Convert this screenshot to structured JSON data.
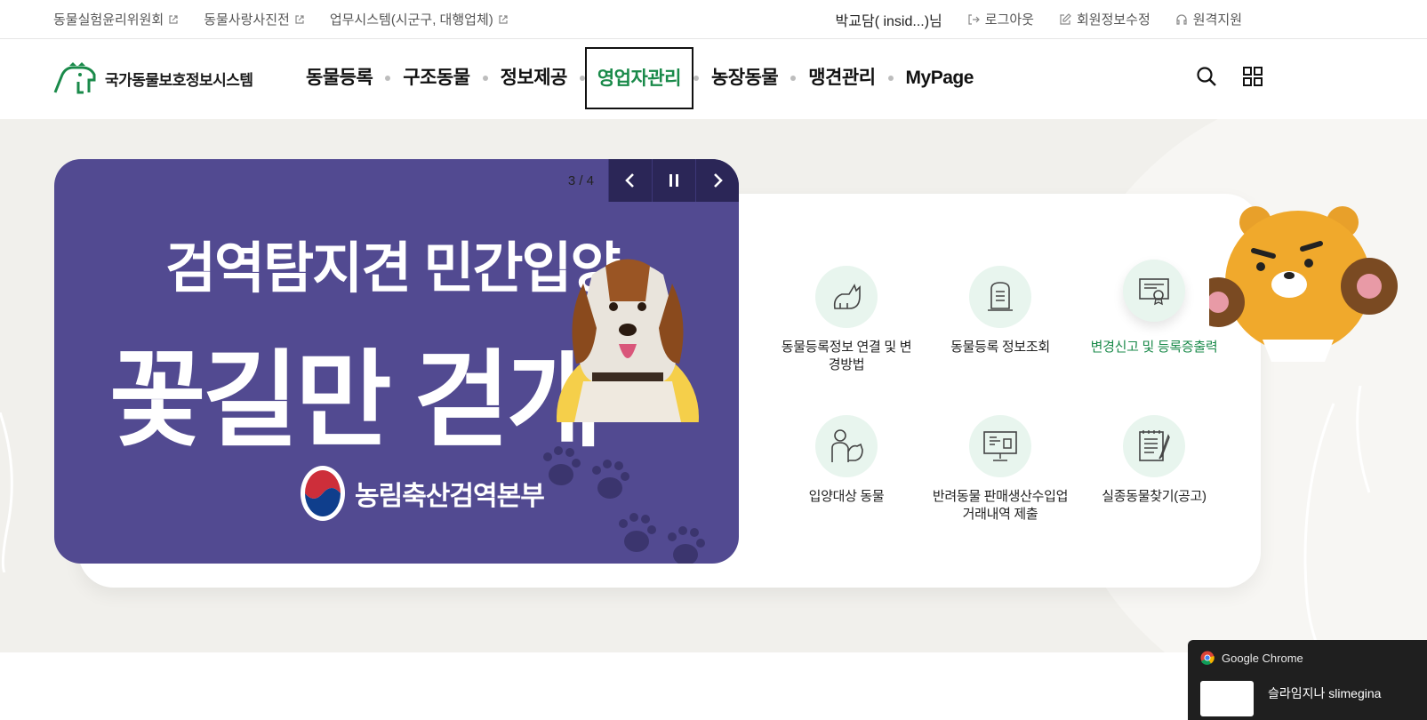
{
  "utility": {
    "links": [
      {
        "label": "동물실험윤리위원회"
      },
      {
        "label": "동물사랑사진전"
      },
      {
        "label": "업무시스템(시군구, 대행업체)"
      }
    ],
    "user_name": "박교담( insid...)님",
    "logout": "로그아웃",
    "edit_profile": "회원정보수정",
    "remote_support": "원격지원"
  },
  "header": {
    "logo_text": "국가동물보호정보시스템",
    "nav": [
      {
        "label": "동물등록"
      },
      {
        "label": "구조동물"
      },
      {
        "label": "정보제공"
      },
      {
        "label": "영업자관리"
      },
      {
        "label": "농장동물"
      },
      {
        "label": "맹견관리"
      },
      {
        "label": "MyPage"
      }
    ],
    "active_index": 3
  },
  "banner": {
    "counter": "3 / 4",
    "title_line1": "검역탐지견 민간입양",
    "title_line2": "꽃길만 걷개",
    "organization": "농림축산검역본부",
    "background_color": "#524a91"
  },
  "quick_menu": [
    {
      "label": "동물등록정보 연결 및 변경방법",
      "icon": "cat-icon"
    },
    {
      "label": "동물등록 정보조회",
      "icon": "tombstone-document-icon"
    },
    {
      "label": "변경신고 및 등록증출력",
      "icon": "certificate-icon"
    },
    {
      "label": "입양대상 동물",
      "icon": "person-with-dog-icon"
    },
    {
      "label": "반려동물 판매생산수입업 거래내역 제출",
      "icon": "monitor-report-icon"
    },
    {
      "label": "실종동물찾기(공고)",
      "icon": "notepad-pen-icon"
    }
  ],
  "toast": {
    "app": "Google Chrome",
    "message": "슬라임지나 slimegina"
  },
  "colors": {
    "accent_green": "#1a8a4a",
    "icon_bg": "#e8f5ee",
    "banner_purple": "#524a91"
  }
}
